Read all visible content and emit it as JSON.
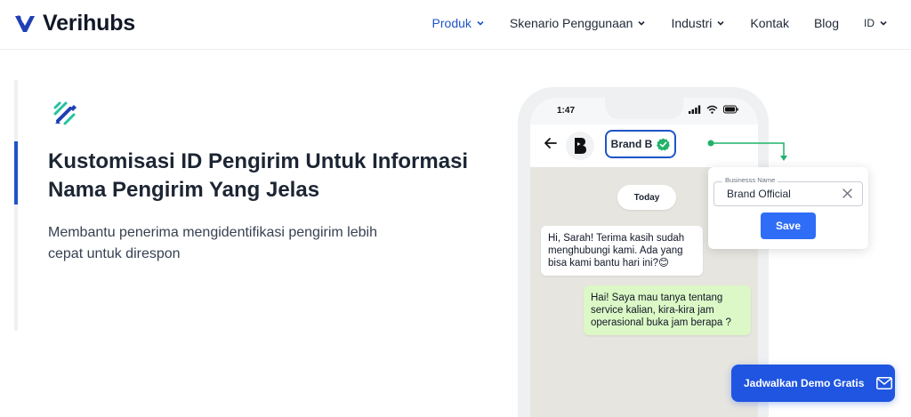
{
  "brand": {
    "name": "Verihubs"
  },
  "nav": {
    "items": [
      {
        "label": "Produk",
        "active": true
      },
      {
        "label": "Skenario Penggunaan",
        "active": false
      },
      {
        "label": "Industri",
        "active": false
      },
      {
        "label": "Kontak",
        "active": false
      },
      {
        "label": "Blog",
        "active": false
      }
    ],
    "language": "ID"
  },
  "hero": {
    "title": "Kustomisasi ID Pengirim Untuk Informasi Nama Pengirim Yang Jelas",
    "description": "Membantu penerima mengidentifikasi pengirim lebih cepat untuk direspon"
  },
  "phone": {
    "time": "1:47",
    "chat_name": "Brand B",
    "date_label": "Today",
    "messages": [
      {
        "from": "business",
        "text": "Hi, Sarah! Terima kasih sudah menghubungi kami. Ada yang bisa kami bantu hari ini?😊"
      },
      {
        "from": "user",
        "text": "Hai! Saya mau tanya tentang service kalian, kira-kira jam operasional buka jam berapa ?"
      }
    ]
  },
  "name_popup": {
    "field_label": "Businesss Name",
    "field_value": "Brand Official",
    "save_label": "Save"
  },
  "cta": {
    "label": "Jadwalkan Demo Gratis"
  },
  "colors": {
    "primary": "#1f55c6",
    "cta": "#1f55e0",
    "verified": "#22b26a",
    "connector": "#1fb36a",
    "out_bubble": "#dcf8c6",
    "chat_bg": "#e7e5df"
  },
  "icons": [
    "verihubs-logo-icon",
    "chevron-down-icon",
    "feature-pencil-icon",
    "back-arrow-icon",
    "signal-icon",
    "wifi-icon",
    "battery-icon",
    "verified-badge-icon",
    "close-icon",
    "mail-icon"
  ]
}
